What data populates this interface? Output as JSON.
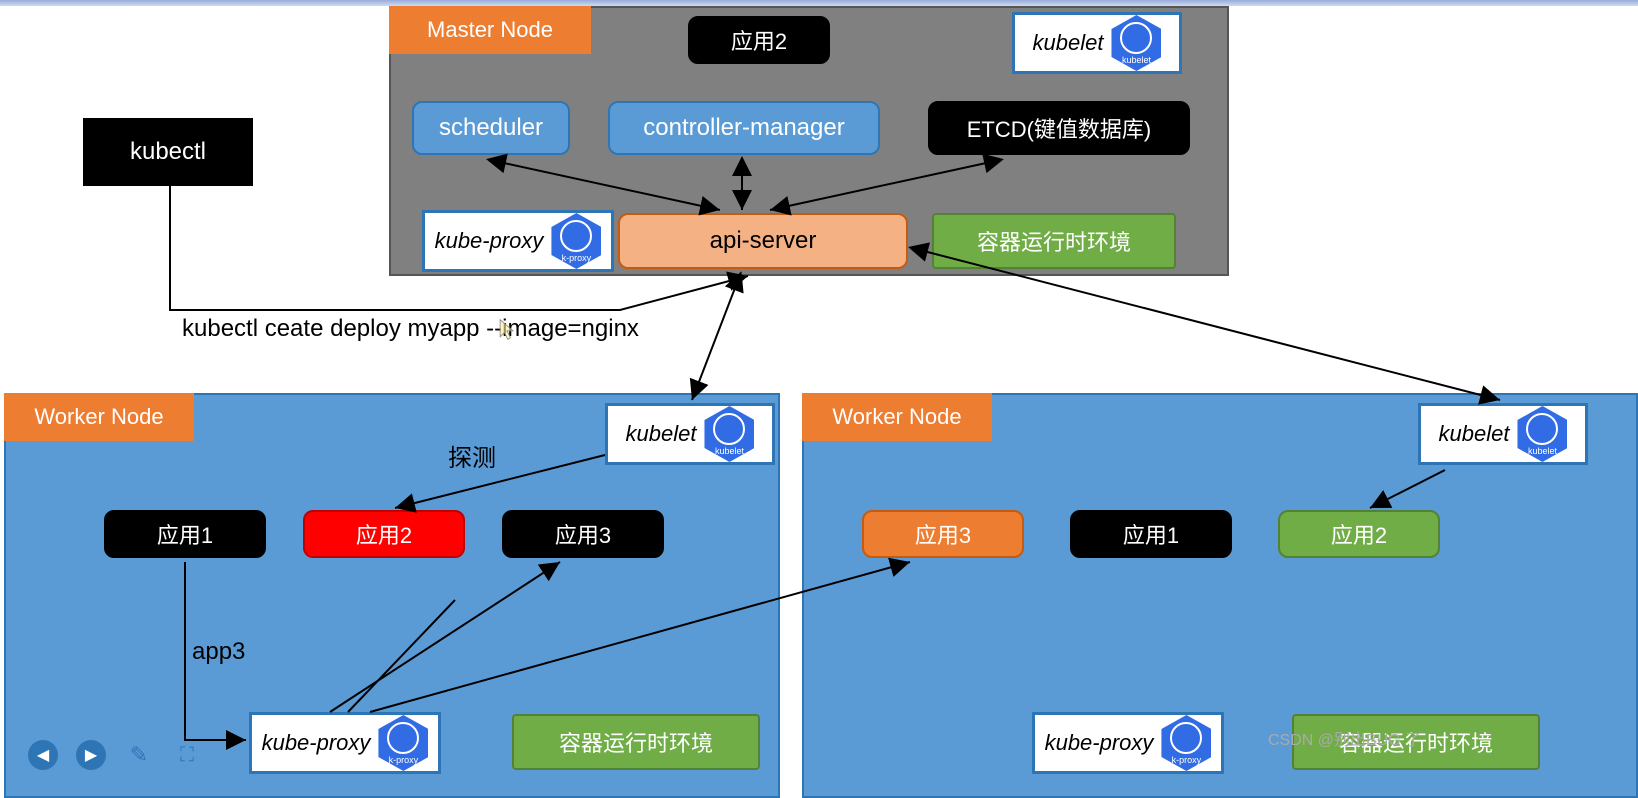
{
  "master": {
    "title": "Master Node",
    "app2": "应用2",
    "scheduler": "scheduler",
    "controller_manager": "controller-manager",
    "etcd": "ETCD(键值数据库)",
    "api_server": "api-server",
    "runtime": "容器运行时环境",
    "kube_proxy": "kube-proxy",
    "kubelet": "kubelet",
    "kubelet_hex": "kubelet",
    "kproxy_hex": "k-proxy"
  },
  "kubectl": {
    "label": "kubectl",
    "command": "kubectl ceate deploy myapp --image=nginx"
  },
  "worker1": {
    "title": "Worker Node",
    "probe": "探测",
    "app1": "应用1",
    "app2": "应用2",
    "app3": "应用3",
    "app3_label": "app3",
    "kubelet": "kubelet",
    "kubelet_hex": "kubelet",
    "kube_proxy": "kube-proxy",
    "kproxy_hex": "k-proxy",
    "runtime": "容器运行时环境"
  },
  "worker2": {
    "title": "Worker Node",
    "app3": "应用3",
    "app1": "应用1",
    "app2": "应用2",
    "kubelet": "kubelet",
    "kubelet_hex": "kubelet",
    "kube_proxy": "kube-proxy",
    "kproxy_hex": "k-proxy",
    "runtime": "容器运行时环境"
  },
  "watermark": "CSDN @别出BUG 了"
}
